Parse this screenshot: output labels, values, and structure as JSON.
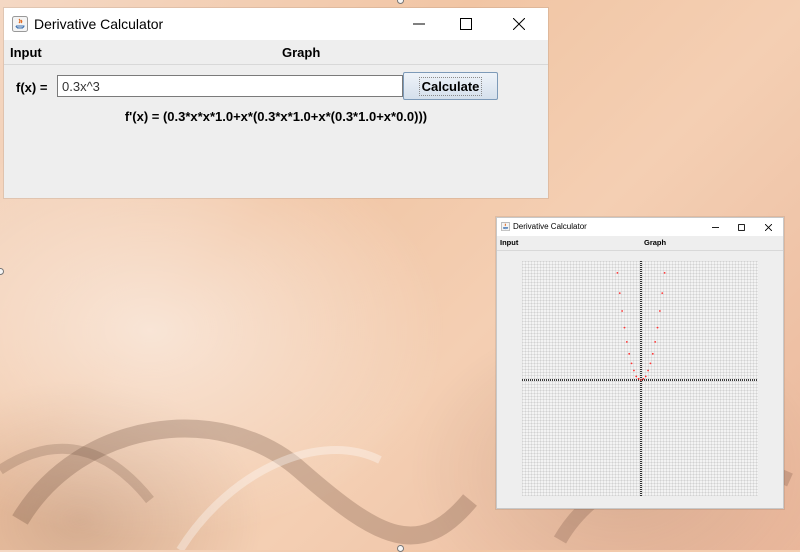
{
  "main_window": {
    "title": "Derivative Calculator",
    "menu": [
      "Input",
      "Graph"
    ],
    "fx_label": "f(x) =",
    "fx_value": "0.3x^3",
    "calculate_label": "Calculate",
    "derivative": "f'(x) = (0.3*x*x*1.0+x*(0.3*x*1.0+x*(0.3*1.0+x*0.0)))"
  },
  "graph_window": {
    "title": "Derivative Calculator",
    "menu": [
      "Input",
      "Graph"
    ]
  },
  "chart_data": {
    "type": "scatter",
    "title": "",
    "xlabel": "",
    "ylabel": "",
    "grid": true,
    "point_color": "#ff3333",
    "axis_color": "#000000",
    "xlim": [
      -10,
      10
    ],
    "ylim": [
      -10,
      10
    ],
    "series": [
      {
        "x": [
          -2.0,
          -1.8,
          -1.6,
          -1.4,
          -1.2,
          -1.0,
          -0.8,
          -0.6,
          -0.4,
          -0.2,
          0.0,
          0.2,
          0.4,
          0.6,
          0.8,
          1.0,
          1.2,
          1.4,
          1.6,
          1.8,
          2.0
        ],
        "y": [
          9.0,
          7.3,
          5.8,
          4.4,
          3.2,
          2.2,
          1.4,
          0.8,
          0.3,
          0.1,
          0.0,
          0.1,
          0.3,
          0.8,
          1.4,
          2.2,
          3.2,
          4.4,
          5.8,
          7.3,
          9.0
        ]
      }
    ]
  }
}
